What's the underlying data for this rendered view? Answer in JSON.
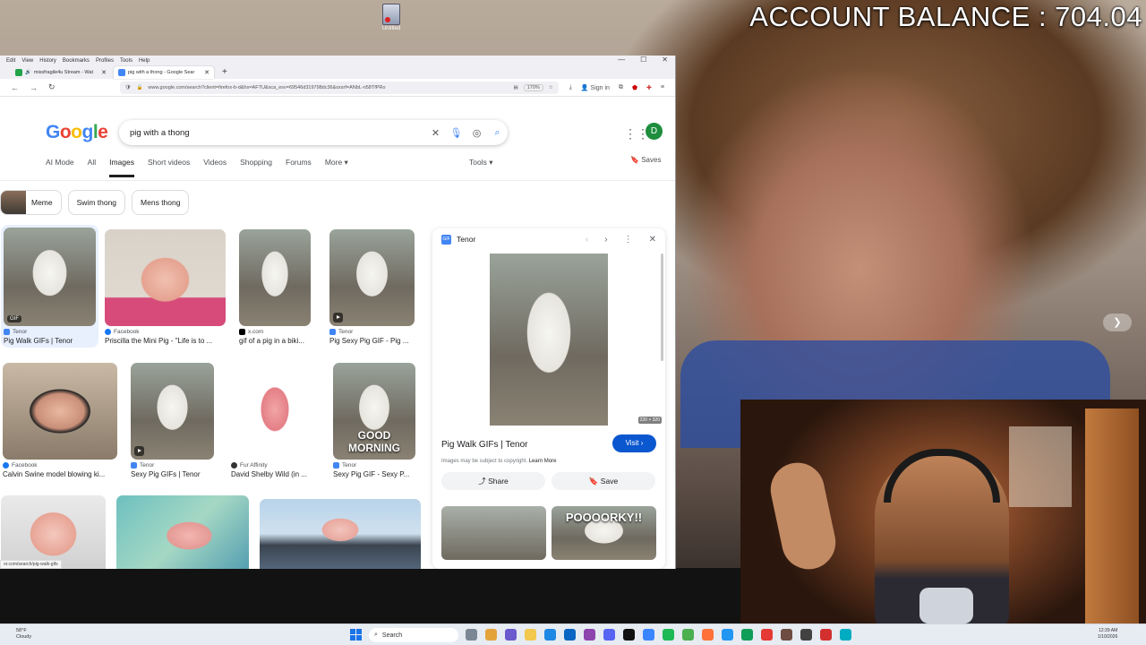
{
  "overlay": {
    "account_balance": "ACCOUNT BALANCE : 704.04",
    "desktop_icon_label": "Untitled"
  },
  "browser": {
    "menu": [
      "Edit",
      "View",
      "History",
      "Bookmarks",
      "Profiles",
      "Tools",
      "Help"
    ],
    "tabs": [
      {
        "label": "missfragile4u Stream - Wat",
        "color": "#22a34a"
      },
      {
        "label": "pig with a thong - Google Sear",
        "color": "#4285f4"
      }
    ],
    "url": "www.google.com/search?client=firefox-b-d&hs=AFTU&sca_esv=69546d319798dc36&sxsrf=ANbL-n58TfPRo",
    "zoom": "170%",
    "signin": "Sign in",
    "status_url": "or.com/search/pig-walk-gifs"
  },
  "google": {
    "logo": [
      "G",
      "o",
      "o",
      "g",
      "l",
      "e"
    ],
    "query": "pig with a thong",
    "avatar": "D",
    "tabs": [
      "AI Mode",
      "All",
      "Images",
      "Short videos",
      "Videos",
      "Shopping",
      "Forums",
      "More ▾"
    ],
    "active_tab": "Images",
    "tools": "Tools ▾",
    "saves": "Saves",
    "chips": [
      "Meme",
      "Swim thong",
      "Mens thong"
    ]
  },
  "results": [
    {
      "source": "Tenor",
      "title": "Pig Walk GIFs | Tenor",
      "badge": "GIF"
    },
    {
      "source": "Facebook",
      "title": "Priscilla the Mini Pig - \"Life is to ..."
    },
    {
      "source": "x.com",
      "title": "gif of a pig in a biki..."
    },
    {
      "source": "Tenor",
      "title": "Pig Sexy Pig GIF - Pig ..."
    },
    {
      "source": "Facebook",
      "title": "Calvin Swine model blowing ki..."
    },
    {
      "source": "Tenor",
      "title": "Sexy Pig GIFs | Tenor"
    },
    {
      "source": "Fur Affinity",
      "title": "David Shelby Wild (in ..."
    },
    {
      "source": "Tenor",
      "title": "Sexy Pig GIF - Sexy P...",
      "overlay": "GOOD MORNING"
    }
  ],
  "panel": {
    "source": "Tenor",
    "dimensions": "220 × 320",
    "title": "Pig Walk GIFs | Tenor",
    "visit": "Visit",
    "copyright": "Images may be subject to copyright.",
    "learn_more": "Learn More",
    "share": "Share",
    "save": "Save",
    "related_overlay": "POOOORKY!!"
  },
  "taskbar": {
    "weather_temp": "58°F",
    "weather_desc": "Cloudy",
    "search": "Search",
    "time": "12:39 AM",
    "date": "1/10/2026"
  },
  "colors": {
    "google_blue": "#4285f4",
    "visit_button": "#0b57d0",
    "avatar": "#1e8e3e"
  }
}
